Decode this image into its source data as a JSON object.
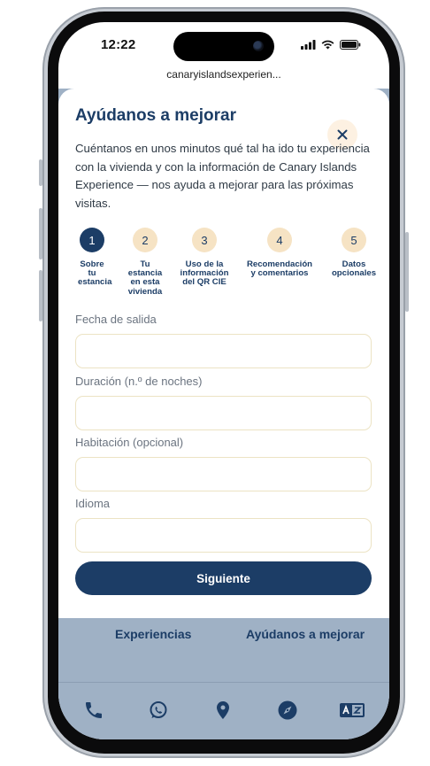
{
  "status_bar": {
    "time": "12:22"
  },
  "browser": {
    "url": "canaryislandsexperien..."
  },
  "sheet": {
    "title": "Ayúdanos a mejorar",
    "intro": "Cuéntanos en unos minutos qué tal ha ido tu experiencia con la vivienda y con la información de Canary Islands Experience — nos ayuda a mejorar para las próximas visitas.",
    "close_symbol": "×",
    "steps": [
      {
        "number": "1",
        "label": "Sobre tu estancia",
        "active": true
      },
      {
        "number": "2",
        "label": "Tu estancia en esta vivienda",
        "active": false
      },
      {
        "number": "3",
        "label": "Uso de la información del QR CIE",
        "active": false
      },
      {
        "number": "4",
        "label": "Recomendación y comentarios",
        "active": false
      },
      {
        "number": "5",
        "label": "Datos opcionales",
        "active": false
      }
    ],
    "fields": [
      {
        "label": "Fecha de salida",
        "value": ""
      },
      {
        "label": "Duración (n.º de noches)",
        "value": ""
      },
      {
        "label": "Habitación (opcional)",
        "value": ""
      },
      {
        "label": "Idioma",
        "value": ""
      }
    ],
    "submit_label": "Siguiente"
  },
  "background_page": {
    "links": [
      "Experiencias",
      "Ayúdanos a mejorar"
    ]
  },
  "bottom_nav": {
    "items": [
      "phone-icon",
      "whatsapp-icon",
      "location-pin-icon",
      "compass-icon",
      "translate-icon"
    ]
  },
  "colors": {
    "primary": "#1c3d66",
    "step_inactive": "#f6e3c4",
    "close_bg": "#fdf1e2",
    "input_border": "#ece3c4",
    "overlay_bg": "#9fb1c5"
  }
}
